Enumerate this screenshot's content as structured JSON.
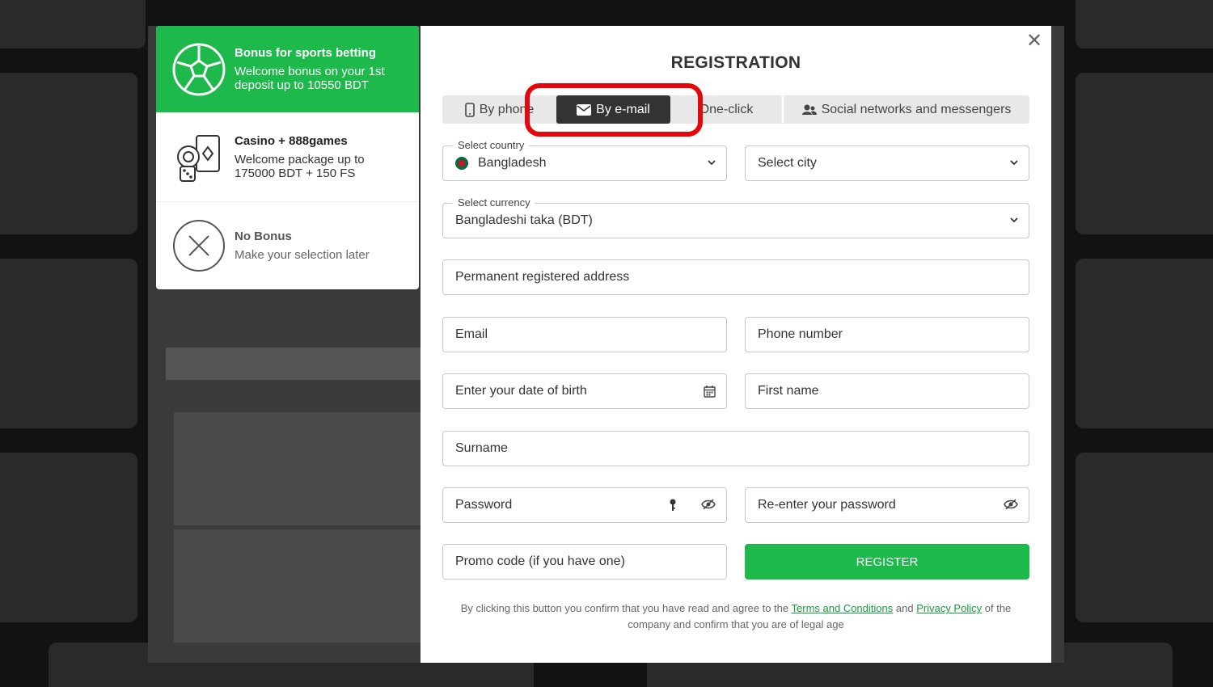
{
  "bonus": {
    "items": [
      {
        "title": "Bonus for sports betting",
        "desc": "Welcome bonus on your 1st deposit up to 10550 BDT"
      },
      {
        "title": "Casino + 888games",
        "desc": "Welcome package up to 175000 BDT + 150 FS"
      },
      {
        "title": "No Bonus",
        "desc": "Make your selection later"
      }
    ]
  },
  "modal": {
    "title": "REGISTRATION",
    "close": "✕",
    "tabs": {
      "phone": "By phone",
      "email": "By e-mail",
      "oneclick": "One-click",
      "social": "Social networks and messengers"
    },
    "fields": {
      "country_label": "Select country",
      "country_value": "Bangladesh",
      "city": "Select city",
      "currency_label": "Select currency",
      "currency_value": "Bangladeshi taka (BDT)",
      "address": "Permanent registered address",
      "email": "Email",
      "phone": "Phone number",
      "dob": "Enter your date of birth",
      "first_name": "First name",
      "surname": "Surname",
      "password": "Password",
      "password_repeat": "Re-enter your password",
      "promo": "Promo code (if you have one)"
    },
    "register_label": "REGISTER",
    "terms": {
      "part1": "By clicking this button you confirm that you have read and agree to the",
      "terms_link": "Terms and Conditions",
      "and": "and",
      "privacy_link": "Privacy Policy",
      "part2": "of the company and confirm that you are of legal age"
    }
  },
  "colors": {
    "accent": "#1db94b",
    "highlight": "#e8060d",
    "tab_active": "#333333"
  }
}
